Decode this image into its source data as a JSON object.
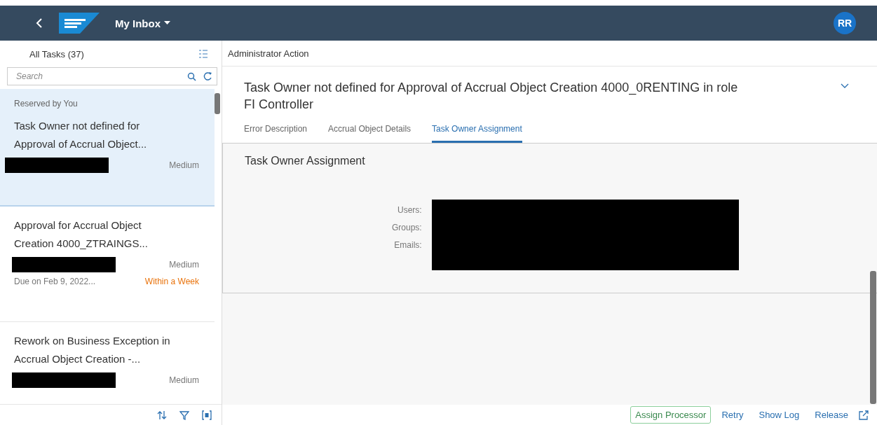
{
  "header": {
    "app_title": "My Inbox",
    "avatar": "RR"
  },
  "task_list": {
    "title": "All Tasks (37)",
    "search": {
      "placeholder": "Search"
    },
    "items": [
      {
        "status": "Reserved by You",
        "title": "Task Owner not defined for Approval of Accrual Object...",
        "redacted": true,
        "priority": "Medium",
        "selected": true
      },
      {
        "title": "Approval for Accrual Object Creation 4000_ZTRAINGS...",
        "redacted": true,
        "priority": "Medium",
        "due": "Due on Feb 9, 2022...",
        "due_label": "Within a Week",
        "selected": false
      },
      {
        "title": "Rework on Business Exception in Accrual Object Creation -...",
        "redacted": true,
        "priority": "Medium",
        "selected": false
      }
    ]
  },
  "detail": {
    "header": "Administrator Action",
    "title": "Task Owner not defined for Approval of Accrual Object Creation 4000_0RENTING in role FI Controller",
    "tabs": [
      {
        "label": "Error Description",
        "selected": false
      },
      {
        "label": "Accrual Object Details",
        "selected": false
      },
      {
        "label": "Task Owner Assignment",
        "selected": true
      }
    ],
    "section": {
      "title": "Task Owner Assignment",
      "labels": [
        "Users:",
        "Groups:",
        "Emails:"
      ],
      "redacted": true
    }
  },
  "footer": {
    "buttons": [
      {
        "label": "Assign Processor",
        "kind": "emphasized"
      },
      {
        "label": "Retry",
        "kind": "link"
      },
      {
        "label": "Show Log",
        "kind": "link"
      },
      {
        "label": "Release",
        "kind": "link"
      }
    ]
  }
}
